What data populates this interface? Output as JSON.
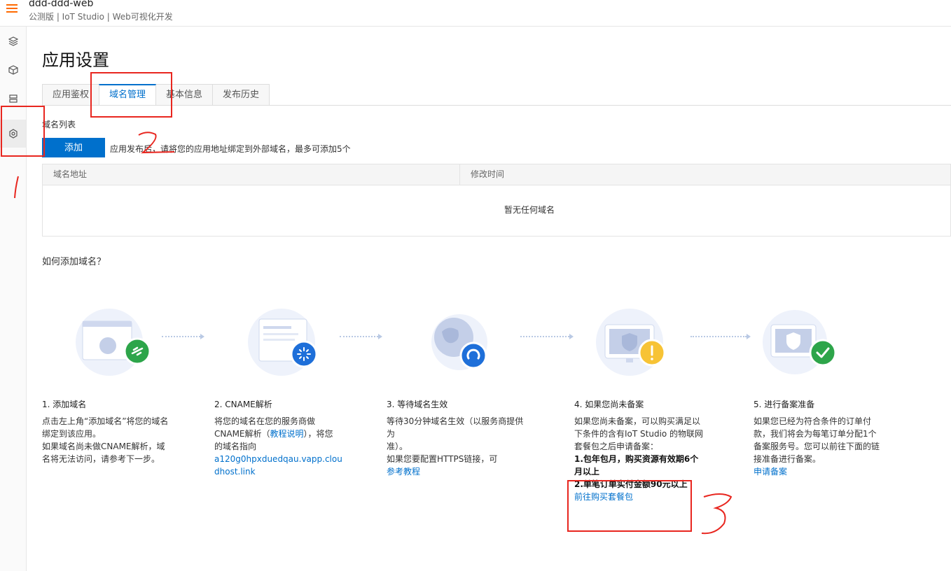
{
  "header": {
    "title": "ddd-ddd-web",
    "subtitle": "公测版 | IoT Studio | Web可视化开发"
  },
  "sidenav": {
    "items": [
      "layers-icon",
      "cube-icon",
      "server-icon",
      "settings-icon"
    ],
    "active": "settings-icon"
  },
  "page": {
    "title": "应用设置",
    "tabs": [
      {
        "label": "应用鉴权",
        "active": false
      },
      {
        "label": "域名管理",
        "active": true
      },
      {
        "label": "基本信息",
        "active": false
      },
      {
        "label": "发布历史",
        "active": false
      }
    ],
    "domain_list": {
      "title": "域名列表",
      "add_button": "添加",
      "hint": "应用发布后，请将您的应用地址绑定到外部域名，最多可添加5个",
      "columns": [
        "域名地址",
        "修改时间"
      ],
      "empty_text": "暂无任何域名"
    },
    "how_to": {
      "title": "如何添加域名？",
      "steps": [
        {
          "title": "1. 添加域名",
          "lines": [
            "点击左上角“添加域名”将您的域名",
            "绑定到该应用。",
            "如果域名尚未做CNAME解析，域",
            "名将无法访问，请参考下一步。"
          ]
        },
        {
          "title": "2. CNAME解析",
          "line1": "将您的域名在您的服务商做",
          "line2_pre": "CNAME解析（",
          "link": "教程说明",
          "line2_post": "），将您",
          "line3": "的域名指向",
          "cname": "a120g0hpxduedqau.vapp.cloudhost.link"
        },
        {
          "title": "3. 等待域名生效",
          "line1": "等待30分钟域名生效（以服务商提供为",
          "line2": "准）。",
          "line3": "如果您要配置HTTPS链接，可",
          "link": "参考教程"
        },
        {
          "title": "4. 如果您尚未备案",
          "line1": "如果您尚未备案，可以购买满足以",
          "line2": "下条件的含有IoT Studio 的物联网",
          "line3": "套餐包之后申请备案：",
          "cond1": "1.包年包月，购买资源有效期6个",
          "cond1b": "月以上",
          "cond2": "2.单笔订单实付金额90元以上",
          "link": "前往购买套餐包"
        },
        {
          "title": "5. 进行备案准备",
          "lines": [
            "如果您已经为符合条件的订单付",
            "款，我们将会为每笔订单分配1个",
            "备案服务号。您可以前往下面的链",
            "接准备进行备案。"
          ],
          "link": "申请备案"
        }
      ]
    }
  },
  "annotations": {
    "marks": [
      "1",
      "2",
      "3"
    ],
    "color": "#e8261f"
  },
  "colors": {
    "primary": "#0070cc",
    "brand": "#ff6a00",
    "success": "#2da54a",
    "warning": "#f7c335"
  }
}
